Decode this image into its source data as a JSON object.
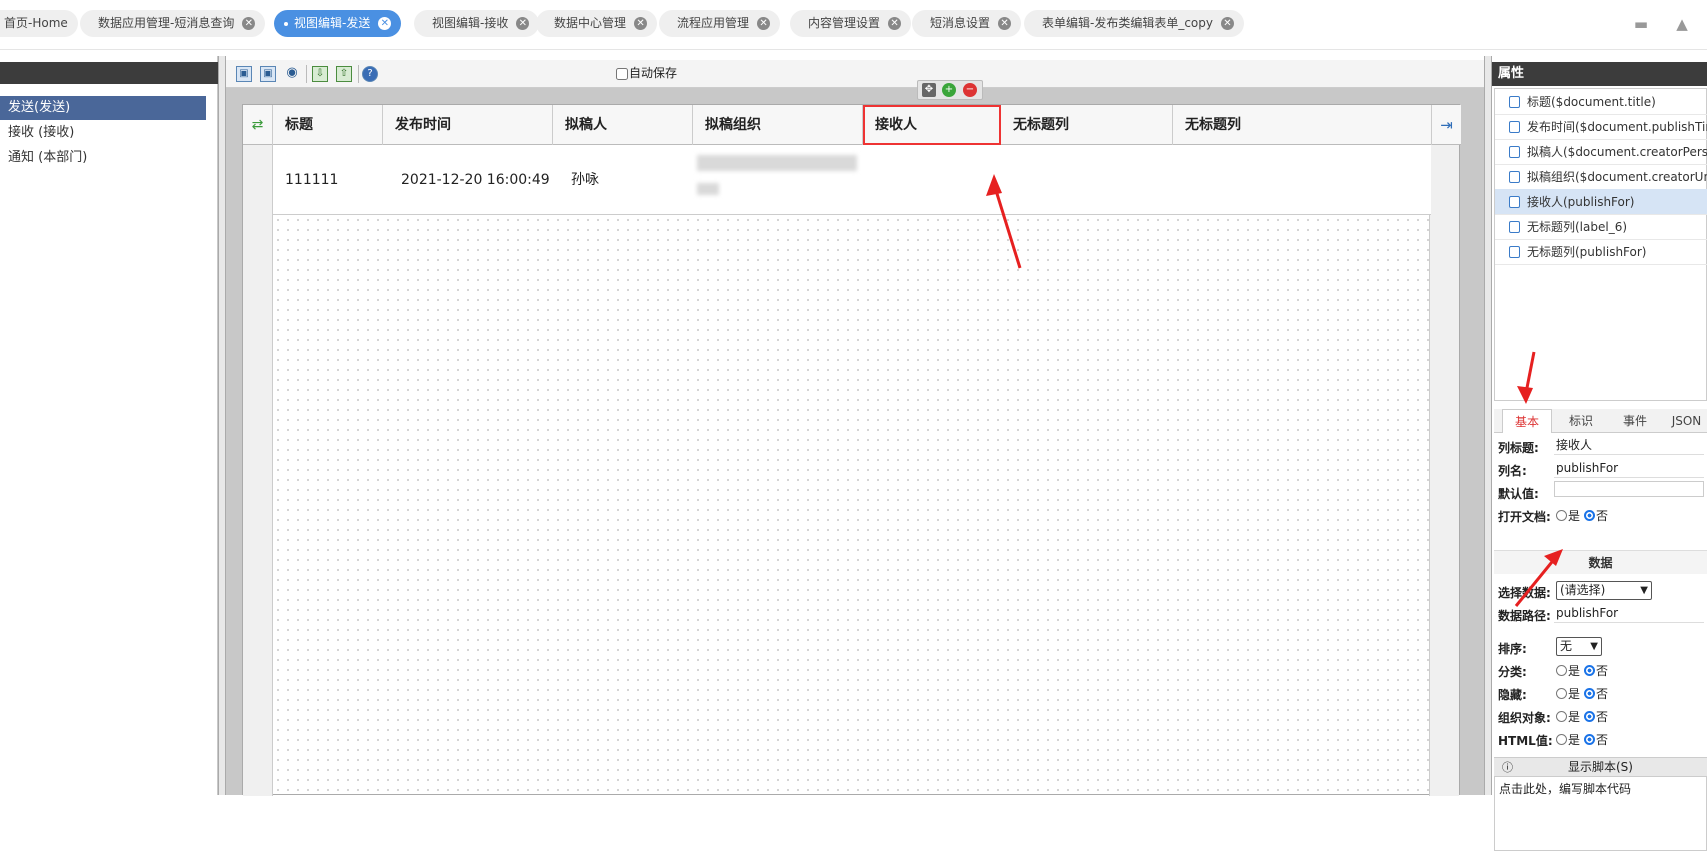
{
  "tabs": [
    {
      "label": "首页-Home",
      "closable": false,
      "active": false
    },
    {
      "label": "数据应用管理-短消息查询",
      "closable": true,
      "active": false
    },
    {
      "label": "视图编辑-发送",
      "closable": true,
      "active": true
    },
    {
      "label": "视图编辑-接收",
      "closable": true,
      "active": false
    },
    {
      "label": "数据中心管理",
      "closable": true,
      "active": false
    },
    {
      "label": "流程应用管理",
      "closable": true,
      "active": false
    },
    {
      "label": "内容管理设置",
      "closable": true,
      "active": false
    },
    {
      "label": "短消息设置",
      "closable": true,
      "active": false
    },
    {
      "label": "表单编辑-发布类编辑表单_copy",
      "closable": true,
      "active": false
    }
  ],
  "top_icons": [
    "chat-icon",
    "shirt-icon"
  ],
  "left_panel": {
    "items": [
      "发送(发送)",
      "接收 (接收)",
      "通知 (本部门)"
    ],
    "selected_index": 0
  },
  "toolbar": {
    "icons": [
      "save-icon",
      "save-as-icon",
      "preview-icon",
      "import-icon",
      "export-icon",
      "help-icon"
    ],
    "autosave_label": "自动保存"
  },
  "grid": {
    "columns": [
      "标题",
      "发布时间",
      "拟稿人",
      "拟稿组织",
      "接收人",
      "无标题列",
      "无标题列"
    ],
    "selected_column": 4,
    "row": [
      "111111",
      "2021-12-20 16:00:49",
      "孙咏",
      "",
      "",
      "",
      ""
    ]
  },
  "properties": {
    "title": "属性",
    "list": [
      "标题($document.title)",
      "发布时间($document.publishTime)",
      "拟稿人($document.creatorPerson)",
      "拟稿组织($document.creatorUnit)",
      "接收人(publishFor)",
      "无标题列(label_6)",
      "无标题列(publishFor)"
    ],
    "list_selected": 4,
    "tabs": [
      "基本",
      "标识",
      "事件",
      "JSON"
    ],
    "active_tab": 0,
    "fields": {
      "col_title_label": "列标题:",
      "col_title_value": "接收人",
      "col_name_label": "列名:",
      "col_name_value": "publishFor",
      "default_label": "默认值:",
      "default_value": "",
      "open_doc_label": "打开文档:"
    },
    "radio_yes": "是",
    "radio_no": "否",
    "data_section": "数据",
    "data_fields": {
      "select_data_label": "选择数据:",
      "select_data_value": "(请选择)",
      "data_path_label": "数据路径:",
      "data_path_value": "publishFor",
      "sort_label": "排序:",
      "sort_value": "无",
      "group_label": "分类:",
      "hidden_label": "隐藏:",
      "org_label": "组织对象:",
      "html_label": "HTML值:"
    },
    "script_bar_label": "显示脚本(S)",
    "script_placeholder": "点击此处，编写脚本代码"
  },
  "colors": {
    "accent": "#4a90e2",
    "selected_item": "#4a6799",
    "highlight": "#e33333"
  }
}
